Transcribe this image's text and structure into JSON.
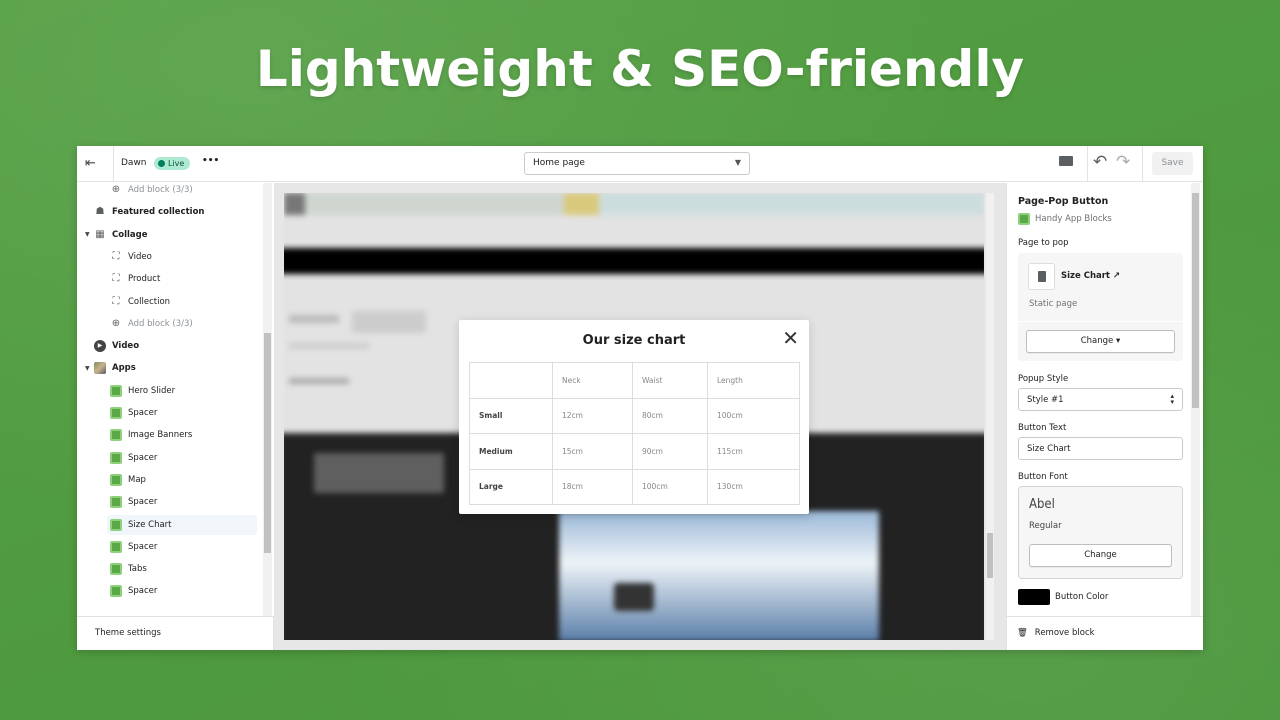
{
  "headline": "Lightweight & SEO-friendly",
  "topbar": {
    "theme": "Dawn",
    "status": "Live",
    "more": "•••",
    "page_select": "Home page",
    "save": "Save",
    "undo": "↶",
    "redo": "↷"
  },
  "sidebar": {
    "items": [
      {
        "label": "Add block (3/3)",
        "level": 2,
        "icon": "plus-circle-icon",
        "muted": true
      },
      {
        "label": "Featured collection",
        "level": 1,
        "icon": "tag-icon"
      },
      {
        "label": "Collage",
        "level": 1,
        "icon": "collage-icon",
        "expanded": true
      },
      {
        "label": "Video",
        "level": 2,
        "icon": "block-icon"
      },
      {
        "label": "Product",
        "level": 2,
        "icon": "block-icon"
      },
      {
        "label": "Collection",
        "level": 2,
        "icon": "block-icon"
      },
      {
        "label": "Add block (3/3)",
        "level": 2,
        "icon": "plus-circle-icon",
        "muted": true
      },
      {
        "label": "Video",
        "level": 1,
        "icon": "play-icon"
      },
      {
        "label": "Apps",
        "level": 1,
        "icon": "apps-icon",
        "expanded": true
      },
      {
        "label": "Hero Slider",
        "level": 2,
        "icon": "app-block-icon"
      },
      {
        "label": "Spacer",
        "level": 2,
        "icon": "app-block-icon"
      },
      {
        "label": "Image Banners",
        "level": 2,
        "icon": "app-block-icon"
      },
      {
        "label": "Spacer",
        "level": 2,
        "icon": "app-block-icon"
      },
      {
        "label": "Map",
        "level": 2,
        "icon": "app-block-icon"
      },
      {
        "label": "Spacer",
        "level": 2,
        "icon": "app-block-icon"
      },
      {
        "label": "Size Chart",
        "level": 2,
        "icon": "app-block-icon",
        "selected": true
      },
      {
        "label": "Spacer",
        "level": 2,
        "icon": "app-block-icon"
      },
      {
        "label": "Tabs",
        "level": 2,
        "icon": "app-block-icon"
      },
      {
        "label": "Spacer",
        "level": 2,
        "icon": "app-block-icon"
      }
    ],
    "footer": "Theme settings"
  },
  "modal": {
    "title": "Our size chart",
    "close": "✕",
    "headers": [
      "",
      "Neck",
      "Waist",
      "Length"
    ],
    "rows": [
      [
        "Small",
        "12cm",
        "80cm",
        "100cm"
      ],
      [
        "Medium",
        "15cm",
        "90cm",
        "115cm"
      ],
      [
        "Large",
        "18cm",
        "100cm",
        "130cm"
      ]
    ]
  },
  "panel": {
    "title": "Page-Pop Button",
    "app": "Handy App Blocks",
    "page_label": "Page to pop",
    "page_name": "Size Chart",
    "page_type": "Static page",
    "change": "Change",
    "popup_style_label": "Popup Style",
    "popup_style": "Style #1",
    "button_text_label": "Button Text",
    "button_text": "Size Chart",
    "button_font_label": "Button Font",
    "font_name": "Abel",
    "font_style": "Regular",
    "font_change": "Change",
    "button_color_label": "Button Color",
    "button_color": "#000000",
    "remove": "Remove block"
  }
}
